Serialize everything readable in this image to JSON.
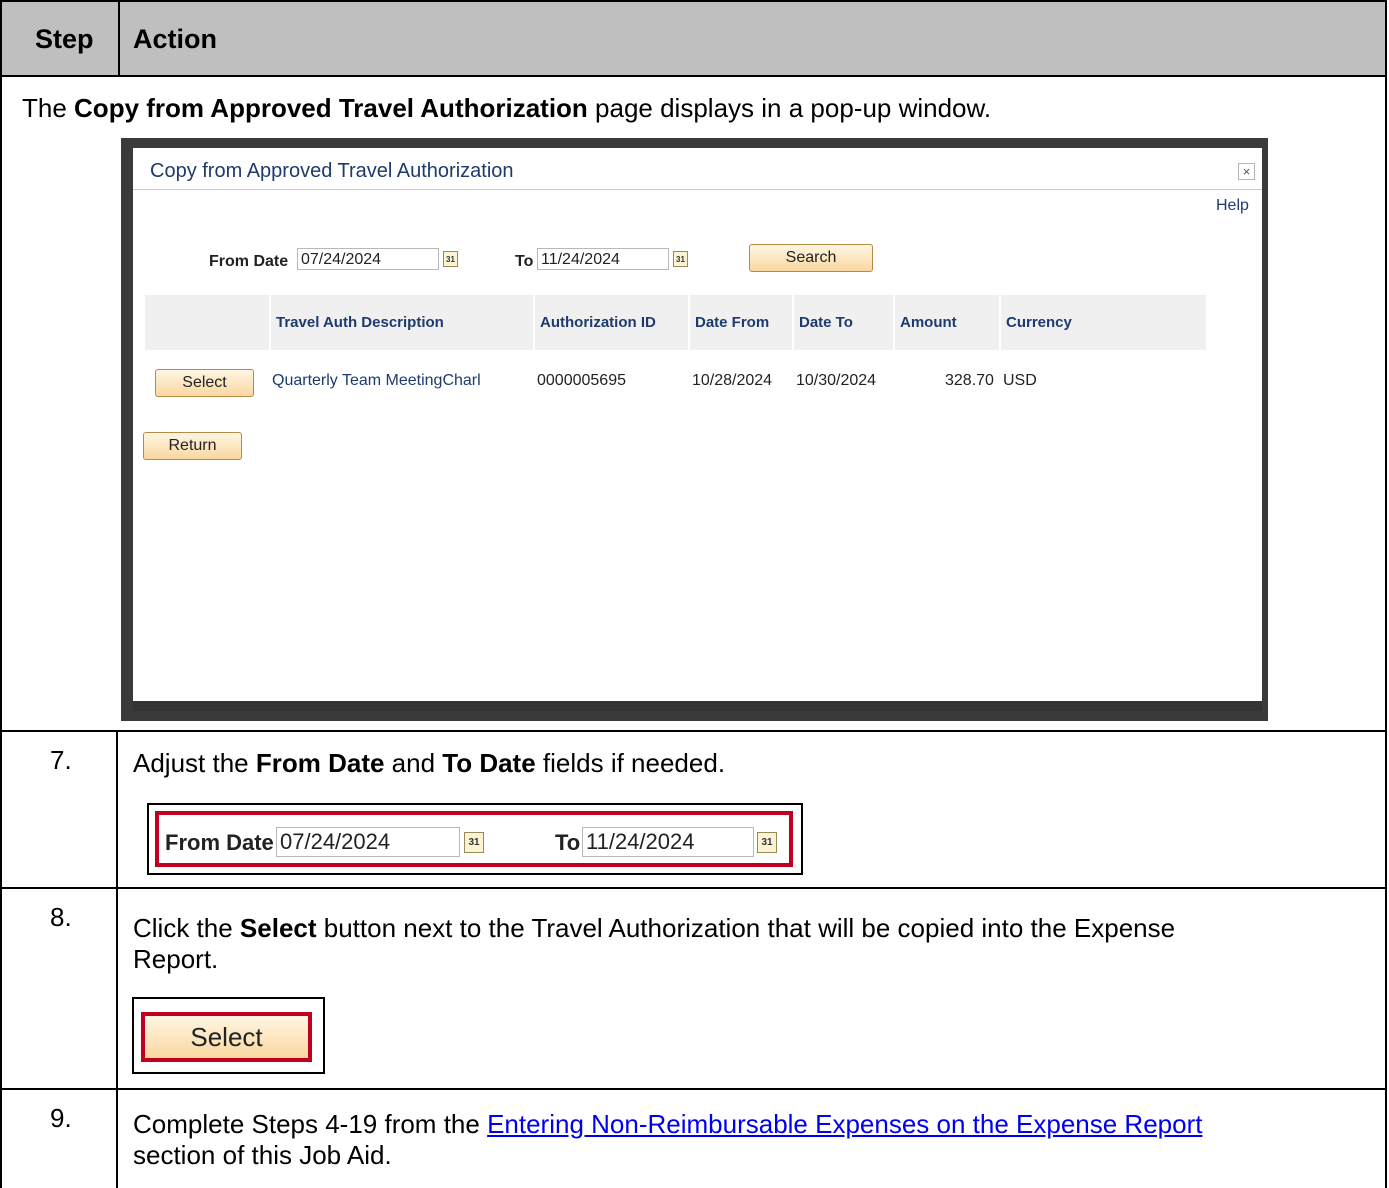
{
  "header": {
    "step": "Step",
    "action": "Action"
  },
  "intro": {
    "prefix": "The ",
    "bold": "Copy from Approved Travel Authorization",
    "suffix": " page displays in a pop-up window."
  },
  "popup": {
    "title": "Copy from Approved Travel Authorization",
    "close": "×",
    "help": "Help",
    "from_label": "From Date",
    "from_value": "07/24/2024",
    "to_label": "To",
    "to_value": "11/24/2024",
    "calendar_glyph": "31",
    "search_label": "Search",
    "columns": [
      "Travel Auth Description",
      "Authorization ID",
      "Date From",
      "Date To",
      "Amount",
      "Currency"
    ],
    "row": {
      "select_label": "Select",
      "description": "Quarterly Team MeetingCharl",
      "auth_id": "0000005695",
      "date_from": "10/28/2024",
      "date_to": "10/30/2024",
      "amount": "328.70",
      "currency": "USD"
    },
    "return_label": "Return"
  },
  "steps": {
    "s7": {
      "num": "7.",
      "t1": "Adjust the ",
      "b1": "From Date",
      "t2": " and ",
      "b2": "To Date",
      "t3": " fields if needed."
    },
    "s8": {
      "num": "8.",
      "t1": "Click the ",
      "b1": "Select",
      "t2": " button next to the Travel Authorization that will be copied into the Expense",
      "t3": "Report.",
      "button": "Select"
    },
    "s9": {
      "num": "9.",
      "t1": "Complete Steps 4-19 from the ",
      "link": "Entering Non-Reimbursable Expenses on the Expense Report",
      "t2": "section of this Job Aid."
    }
  }
}
